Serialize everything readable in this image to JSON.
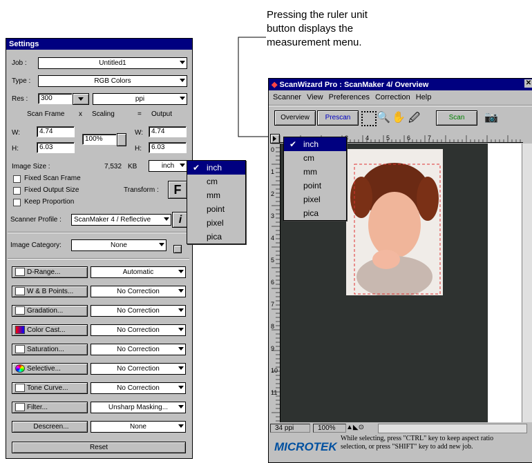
{
  "callout": {
    "text_line1": "Pressing the ruler unit",
    "text_line2": "button displays the",
    "text_line3": "measurement menu."
  },
  "settings": {
    "title": "Settings",
    "job_label": "Job :",
    "job_value": "Untitled1",
    "type_label": "Type :",
    "type_value": "RGB Colors",
    "res_label": "Res :",
    "res_value": "300",
    "res_unit": "ppi",
    "scan_frame": "Scan Frame",
    "x": "x",
    "scaling": "Scaling",
    "eq": "=",
    "output": "Output",
    "w_label": "W:",
    "w_value": "4.74",
    "h_label": "H:",
    "h_value": "6.03",
    "scale_value": "100%",
    "ow_label": "W:",
    "ow_value": "4.74",
    "oh_label": "H:",
    "oh_value": "6.03",
    "image_size_label": "Image Size :",
    "image_size_value": "7,532",
    "image_size_unit": "KB",
    "unit_value": "inch",
    "fixed_scan": "Fixed Scan Frame",
    "fixed_output": "Fixed Output Size",
    "keep_prop": "Keep Proportion",
    "transform_label": "Transform :",
    "transform_icon": "F",
    "profile_label": "Scanner Profile :",
    "profile_value": "ScanMaker 4 / Reflective",
    "info_icon": "i",
    "category_label": "Image Category:",
    "category_value": "None",
    "rows": [
      {
        "btn": "D-Range...",
        "val": "Automatic"
      },
      {
        "btn": "W & B Points...",
        "val": "No Correction"
      },
      {
        "btn": "Gradation...",
        "val": "No Correction"
      },
      {
        "btn": "Color Cast...",
        "val": "No Correction"
      },
      {
        "btn": "Saturation...",
        "val": "No Correction"
      },
      {
        "btn": "Selective...",
        "val": "No Correction"
      },
      {
        "btn": "Tone Curve...",
        "val": "No Correction"
      },
      {
        "btn": "Filter...",
        "val": "Unsharp Masking..."
      },
      {
        "btn": "Descreen...",
        "val": "None"
      }
    ],
    "reset": "Reset"
  },
  "unit_menu_left": [
    "inch",
    "cm",
    "mm",
    "point",
    "pixel",
    "pica"
  ],
  "scanwizard": {
    "title": "ScanWizard Pro : ScanMaker 4/ Overview",
    "menus": [
      "Scanner",
      "View",
      "Preferences",
      "Correction",
      "Help"
    ],
    "overview": "Overview",
    "prescan": "Prescan",
    "scan": "Scan",
    "ruler_numbers": [
      "3",
      "4",
      "5",
      "6",
      "7"
    ],
    "vruler_numbers": [
      "0",
      "1",
      "2",
      "3",
      "4",
      "5",
      "6",
      "7",
      "8",
      "9",
      "10",
      "11"
    ],
    "status_res": "34 ppi",
    "status_zoom": "100%",
    "brand": "MICROTEK",
    "hint_line1": "While selecting, press \"CTRL\" key to keep aspect ratio",
    "hint_line2": "selection, or press \"SHIFT\" key to add new job."
  },
  "unit_menu_right": [
    "inch",
    "cm",
    "mm",
    "point",
    "pixel",
    "pica"
  ]
}
